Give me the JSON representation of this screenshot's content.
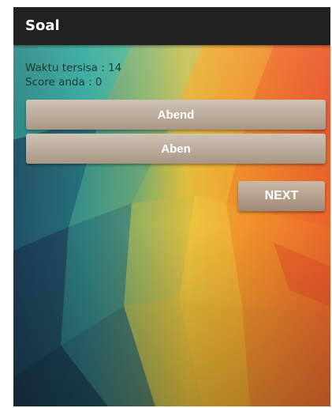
{
  "appbar": {
    "title": "Soal"
  },
  "status": {
    "timer_text": "Waktu tersisa : 14",
    "score_text": "Score anda : 0"
  },
  "answers": [
    {
      "label": "Abend"
    },
    {
      "label": "Aben"
    }
  ],
  "next_label": "NEXT",
  "colors": {
    "appbar": "#212121",
    "button_top": "#cfc3b3",
    "button_bottom": "#a89684",
    "text_on_button": "#ffffff"
  }
}
